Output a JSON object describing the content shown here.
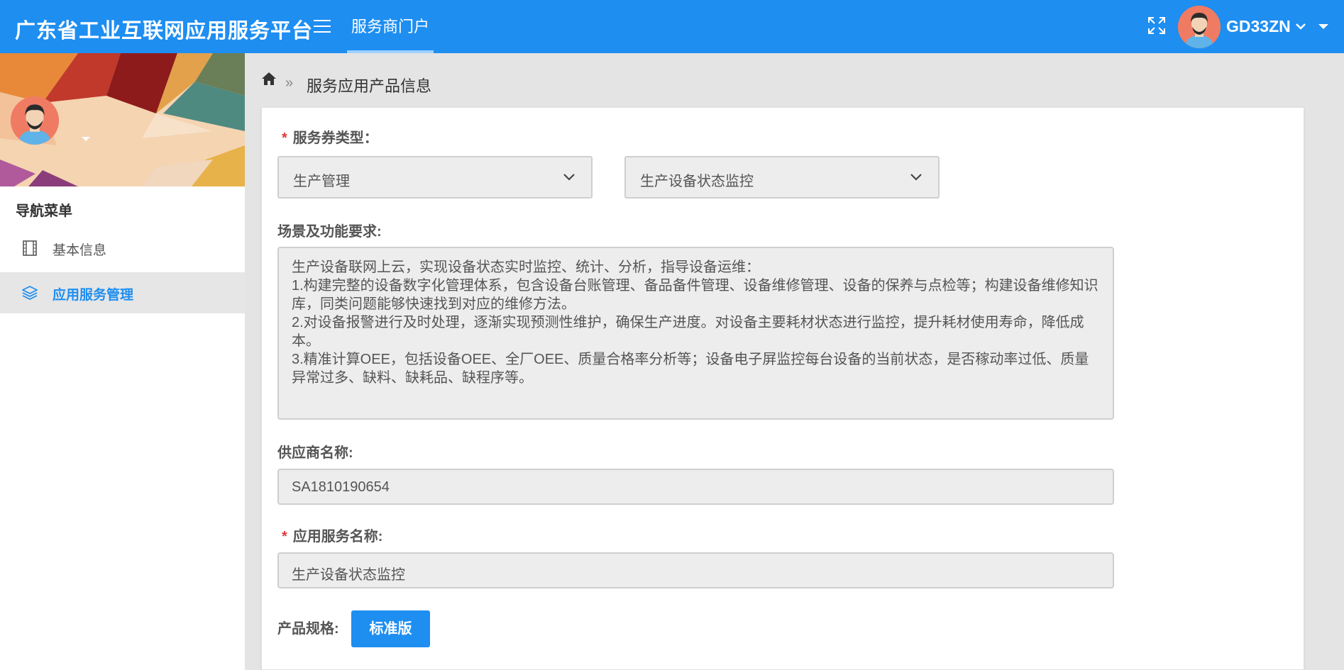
{
  "header": {
    "brand": "广东省工业互联网应用服务平台",
    "portal_tab": "服务商门户",
    "username": "GD33ZN",
    "accent_color": "#1e8ef1",
    "icons": [
      "menu-icon",
      "fullscreen-icon",
      "chevron-down-icon",
      "caret-down-icon"
    ]
  },
  "sidebar": {
    "nav_title": "导航菜单",
    "items": [
      {
        "label": "基本信息",
        "icon": "film-icon",
        "active": false
      },
      {
        "label": "应用服务管理",
        "icon": "layers-icon",
        "active": true
      }
    ]
  },
  "breadcrumb": {
    "separator": "»",
    "current": "服务应用产品信息"
  },
  "form": {
    "coupon_type_label": "服务券类型：",
    "category_select": "生产管理",
    "subcategory_select": "生产设备状态监控",
    "requirements_label": "场景及功能要求:",
    "requirements_text": "生产设备联网上云，实现设备状态实时监控、统计、分析，指导设备运维：\n1.构建完整的设备数字化管理体系，包含设备台账管理、备品备件管理、设备维修管理、设备的保养与点检等；构建设备维修知识库，同类问题能够快速找到对应的维修方法。\n2.对设备报警进行及时处理，逐渐实现预测性维护，确保生产进度。对设备主要耗材状态进行监控，提升耗材使用寿命，降低成本。\n3.精准计算OEE，包括设备OEE、全厂OEE、质量合格率分析等；设备电子屏监控每台设备的当前状态，是否稼动率过低、质量异常过多、缺料、缺耗品、缺程序等。",
    "supplier_label": "供应商名称:",
    "supplier_value": "SA1810190654",
    "service_name_label": "应用服务名称:",
    "service_name_value": "生产设备状态监控",
    "spec_label": "产品规格:",
    "spec_button": "标准版",
    "required_mark": "*"
  }
}
